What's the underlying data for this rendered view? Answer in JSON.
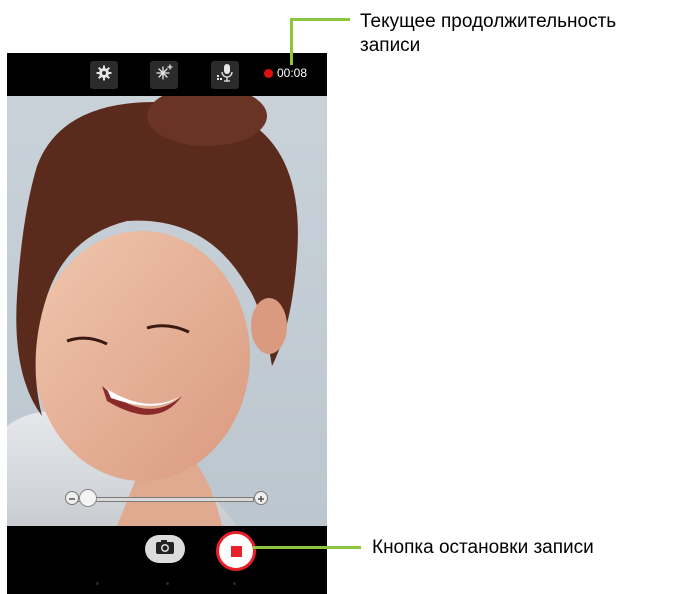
{
  "topbar": {
    "settings_icon": "gear-icon",
    "effects_icon": "sparkle-effects-icon",
    "audio_icon": "microphone-icon",
    "recording_time": "00:08"
  },
  "zoom": {
    "minus_icon": "zoom-out-icon",
    "plus_icon": "zoom-in-icon",
    "level": 0.0
  },
  "bottombar": {
    "snapshot_icon": "camera-icon",
    "stop_icon": "stop-icon"
  },
  "callouts": {
    "duration": {
      "line1": "Текущее продолжительность",
      "line2": "записи"
    },
    "stop": {
      "text": "Кнопка остановки записи"
    }
  },
  "colors": {
    "callout_line": "#8cc63f",
    "record_red": "#e01010",
    "stop_red": "#e8202a"
  }
}
